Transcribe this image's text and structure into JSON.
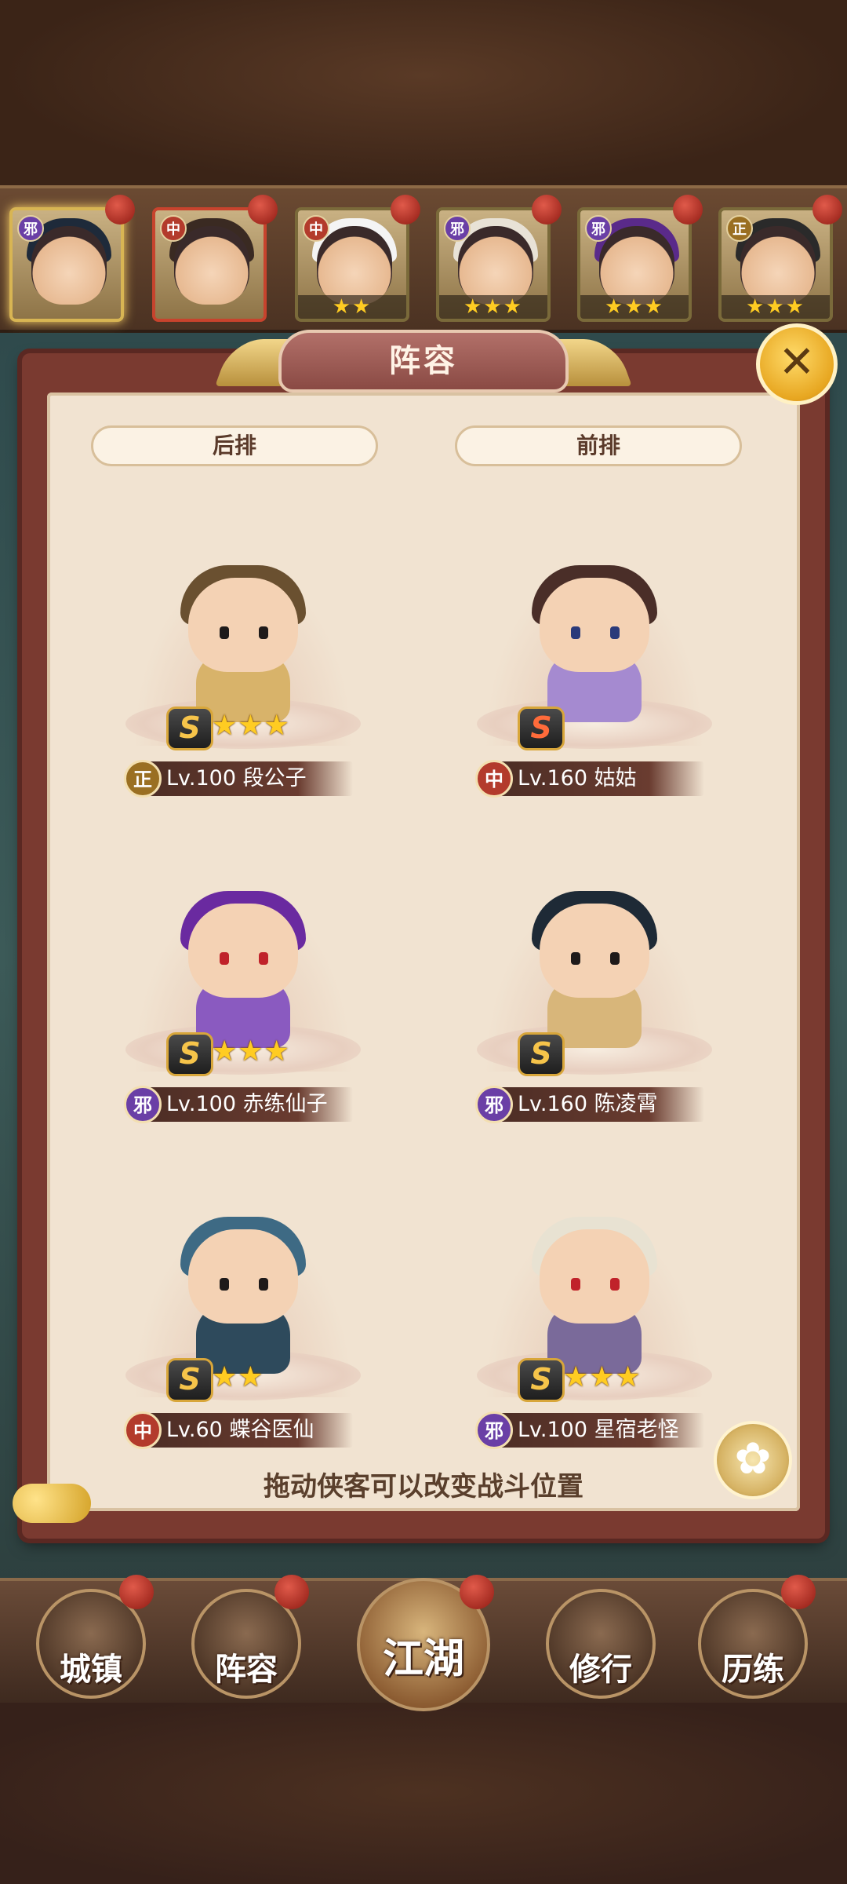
{
  "panel": {
    "title": "阵容",
    "close_glyph": "✕",
    "back_row_label": "后排",
    "front_row_label": "前排",
    "hint": "拖动侠客可以改变战斗位置"
  },
  "roster": [
    {
      "faction": "邪",
      "stars": ""
    },
    {
      "faction": "中",
      "stars": ""
    },
    {
      "faction": "中",
      "stars": "★★"
    },
    {
      "faction": "邪",
      "stars": "★★★"
    },
    {
      "faction": "邪",
      "stars": "★★★"
    },
    {
      "faction": "正",
      "stars": "★★★"
    }
  ],
  "lineup": [
    {
      "faction": "正",
      "level": "Lv.100",
      "name": "段公子",
      "rank": "S",
      "stars": "★★★"
    },
    {
      "faction": "中",
      "level": "Lv.160",
      "name": "姑姑",
      "rank": "S",
      "stars": ""
    },
    {
      "faction": "邪",
      "level": "Lv.100",
      "name": "赤练仙子",
      "rank": "S",
      "stars": "★★★"
    },
    {
      "faction": "邪",
      "level": "Lv.160",
      "name": "陈凌霄",
      "rank": "S",
      "stars": ""
    },
    {
      "faction": "中",
      "level": "Lv.60",
      "name": "蝶谷医仙",
      "rank": "S",
      "stars": "★★"
    },
    {
      "faction": "邪",
      "level": "Lv.100",
      "name": "星宿老怪",
      "rank": "S",
      "stars": "★★★"
    }
  ],
  "nav": [
    {
      "label": "城镇"
    },
    {
      "label": "阵容"
    },
    {
      "label": "江湖"
    },
    {
      "label": "修行"
    },
    {
      "label": "历练"
    }
  ],
  "icons": {
    "close": "close-icon",
    "flower": "flower-icon",
    "faction_colors": {
      "正": "#9a6f22",
      "中": "#b33b2c",
      "邪": "#6a3fa6"
    }
  }
}
